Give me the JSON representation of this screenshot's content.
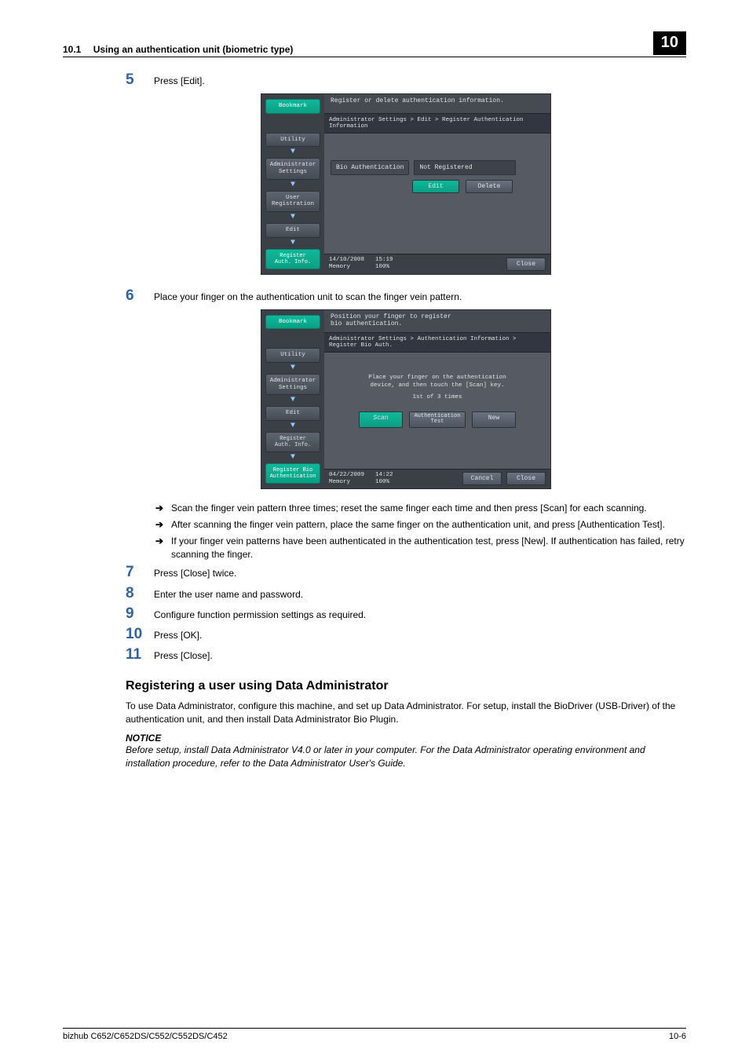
{
  "header": {
    "section_no": "10.1",
    "section_title": "Using an authentication unit (biometric type)",
    "chapter": "10"
  },
  "steps": {
    "s5": {
      "num": "5",
      "text": "Press [Edit]."
    },
    "s6": {
      "num": "6",
      "text": "Place your finger on the authentication unit to scan the finger vein pattern."
    },
    "s7": {
      "num": "7",
      "text": "Press [Close] twice."
    },
    "s8": {
      "num": "8",
      "text": "Enter the user name and password."
    },
    "s9": {
      "num": "9",
      "text": "Configure function permission settings as required."
    },
    "s10": {
      "num": "10",
      "text": "Press [OK]."
    },
    "s11": {
      "num": "11",
      "text": "Press [Close]."
    }
  },
  "panel1": {
    "msg": "Register or delete authentication information.",
    "crumb": "Administrator Settings > Edit > Register Authentication Information",
    "left": {
      "bookmark": "Bookmark",
      "utility": "Utility",
      "admin": "Administrator\nSettings",
      "userreg": "User\nRegistration",
      "edit": "Edit",
      "regauth": "Register\nAuth. Info."
    },
    "bio_label": "Bio Authentication",
    "bio_status": "Not Registered",
    "edit_btn": "Edit",
    "delete_btn": "Delete",
    "date": "14/10/2008",
    "time": "15:19",
    "mem_lbl": "Memory",
    "mem_val": "100%",
    "close": "Close"
  },
  "panel2": {
    "msg": "Position your finger to register\nbio authentication.",
    "crumb": "Administrator Settings > Authentication Information > Register Bio Auth.",
    "left": {
      "bookmark": "Bookmark",
      "utility": "Utility",
      "admin": "Administrator\nSettings",
      "edit": "Edit",
      "regauth": "Register\nAuth. Info.",
      "regbio": "Register Bio\nAuthentication"
    },
    "instr1": "Place your finger on the authentication\ndevice, and then touch the [Scan] key.",
    "instr2": "1st of 3 times",
    "scan_btn": "Scan",
    "test_btn": "Authentication\nTest",
    "new_btn": "New",
    "date": "04/22/2009",
    "time": "14:22",
    "mem_lbl": "Memory",
    "mem_val": "100%",
    "cancel": "Cancel",
    "close": "Close"
  },
  "bullets": {
    "b1": "Scan the finger vein pattern three times; reset the same finger each time and then press [Scan] for each scanning.",
    "b2": "After scanning the finger vein pattern, place the same finger on the authentication unit, and press [Authentication Test].",
    "b3": "If your finger vein patterns have been authenticated in the authentication test, press [New]. If authentication has failed, retry scanning the finger."
  },
  "section": {
    "heading": "Registering a user using Data Administrator",
    "para": "To use Data Administrator, configure this machine, and set up Data Administrator. For setup, install the BioDriver (USB-Driver) of the authentication unit, and then install Data Administrator Bio Plugin.",
    "notice_h": "NOTICE",
    "notice_t": "Before setup, install Data Administrator V4.0 or later in your computer. For the Data Administrator operating environment and installation procedure, refer to the Data Administrator User's Guide."
  },
  "footer": {
    "model": "bizhub C652/C652DS/C552/C552DS/C452",
    "page": "10-6"
  }
}
